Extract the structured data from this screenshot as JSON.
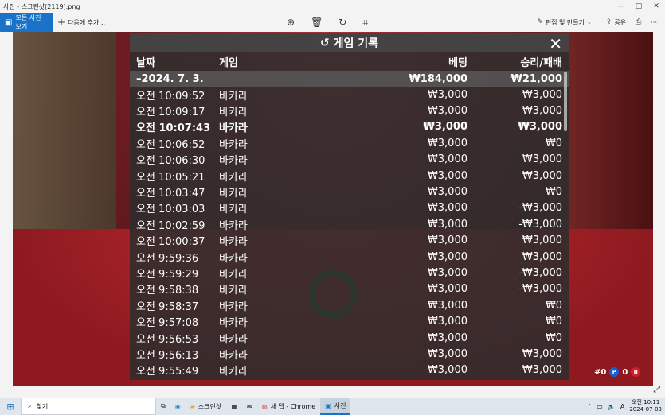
{
  "window": {
    "title": "사진 - 스크린샷(2119).png",
    "controls": {
      "minimize": "—",
      "maximize": "▢",
      "close": "✕"
    }
  },
  "toolbar": {
    "all_photos": "모든 사진 보기",
    "add_to": "다음에 추가...",
    "edit_create": "편집 및 만들기",
    "share": "공유",
    "print_icon": "print-icon",
    "more": "···"
  },
  "history": {
    "title": "게임 기록",
    "columns": {
      "date": "날짜",
      "game": "게임",
      "bet": "베팅",
      "result": "승리/패배"
    },
    "date_row": {
      "date": "–2024. 7. 3.",
      "bet": "₩184,000",
      "result": "₩21,000"
    },
    "rows": [
      {
        "time": "오전 10:09:52",
        "game": "바카라",
        "bet": "₩3,000",
        "result": "-₩3,000"
      },
      {
        "time": "오전 10:09:17",
        "game": "바카라",
        "bet": "₩3,000",
        "result": "₩3,000"
      },
      {
        "time": "오전 10:07:43",
        "game": "바카라",
        "bet": "₩3,000",
        "result": "₩3,000"
      },
      {
        "time": "오전 10:06:52",
        "game": "바카라",
        "bet": "₩3,000",
        "result": "₩0"
      },
      {
        "time": "오전 10:06:30",
        "game": "바카라",
        "bet": "₩3,000",
        "result": "₩3,000"
      },
      {
        "time": "오전 10:05:21",
        "game": "바카라",
        "bet": "₩3,000",
        "result": "₩3,000"
      },
      {
        "time": "오전 10:03:47",
        "game": "바카라",
        "bet": "₩3,000",
        "result": "₩0"
      },
      {
        "time": "오전 10:03:03",
        "game": "바카라",
        "bet": "₩3,000",
        "result": "-₩3,000"
      },
      {
        "time": "오전 10:02:59",
        "game": "바카라",
        "bet": "₩3,000",
        "result": "-₩3,000"
      },
      {
        "time": "오전 10:00:37",
        "game": "바카라",
        "bet": "₩3,000",
        "result": "₩3,000"
      },
      {
        "time": "오전 9:59:36",
        "game": "바카라",
        "bet": "₩3,000",
        "result": "₩3,000"
      },
      {
        "time": "오전 9:59:29",
        "game": "바카라",
        "bet": "₩3,000",
        "result": "-₩3,000"
      },
      {
        "time": "오전 9:58:38",
        "game": "바카라",
        "bet": "₩3,000",
        "result": "-₩3,000"
      },
      {
        "time": "오전 9:58:37",
        "game": "바카라",
        "bet": "₩3,000",
        "result": "₩0"
      },
      {
        "time": "오전 9:57:08",
        "game": "바카라",
        "bet": "₩3,000",
        "result": "₩0"
      },
      {
        "time": "오전 9:56:53",
        "game": "바카라",
        "bet": "₩3,000",
        "result": "₩0"
      },
      {
        "time": "오전 9:56:13",
        "game": "바카라",
        "bet": "₩3,000",
        "result": "₩3,000"
      },
      {
        "time": "오전 9:55:49",
        "game": "바카라",
        "bet": "₩3,000",
        "result": "-₩3,000"
      }
    ]
  },
  "game_overlay": {
    "counters": [
      {
        "letter": "",
        "value": "#0",
        "color": "#ffffff"
      },
      {
        "letter": "P",
        "value": "0",
        "color": "#1a5fd0"
      },
      {
        "letter": "B",
        "value": "",
        "color": "#d0212b"
      }
    ]
  },
  "taskbar": {
    "search": "찾기",
    "apps": [
      {
        "label": "스크린샷",
        "icon": "folder-icon",
        "active": false
      },
      {
        "label": "새 탭 - Chrome",
        "icon": "chrome-icon",
        "active": false
      },
      {
        "label": "사진",
        "icon": "photos-icon",
        "active": true
      }
    ],
    "tray_lang": "A",
    "time": "오전 10:11",
    "date": "2024-07-03"
  }
}
